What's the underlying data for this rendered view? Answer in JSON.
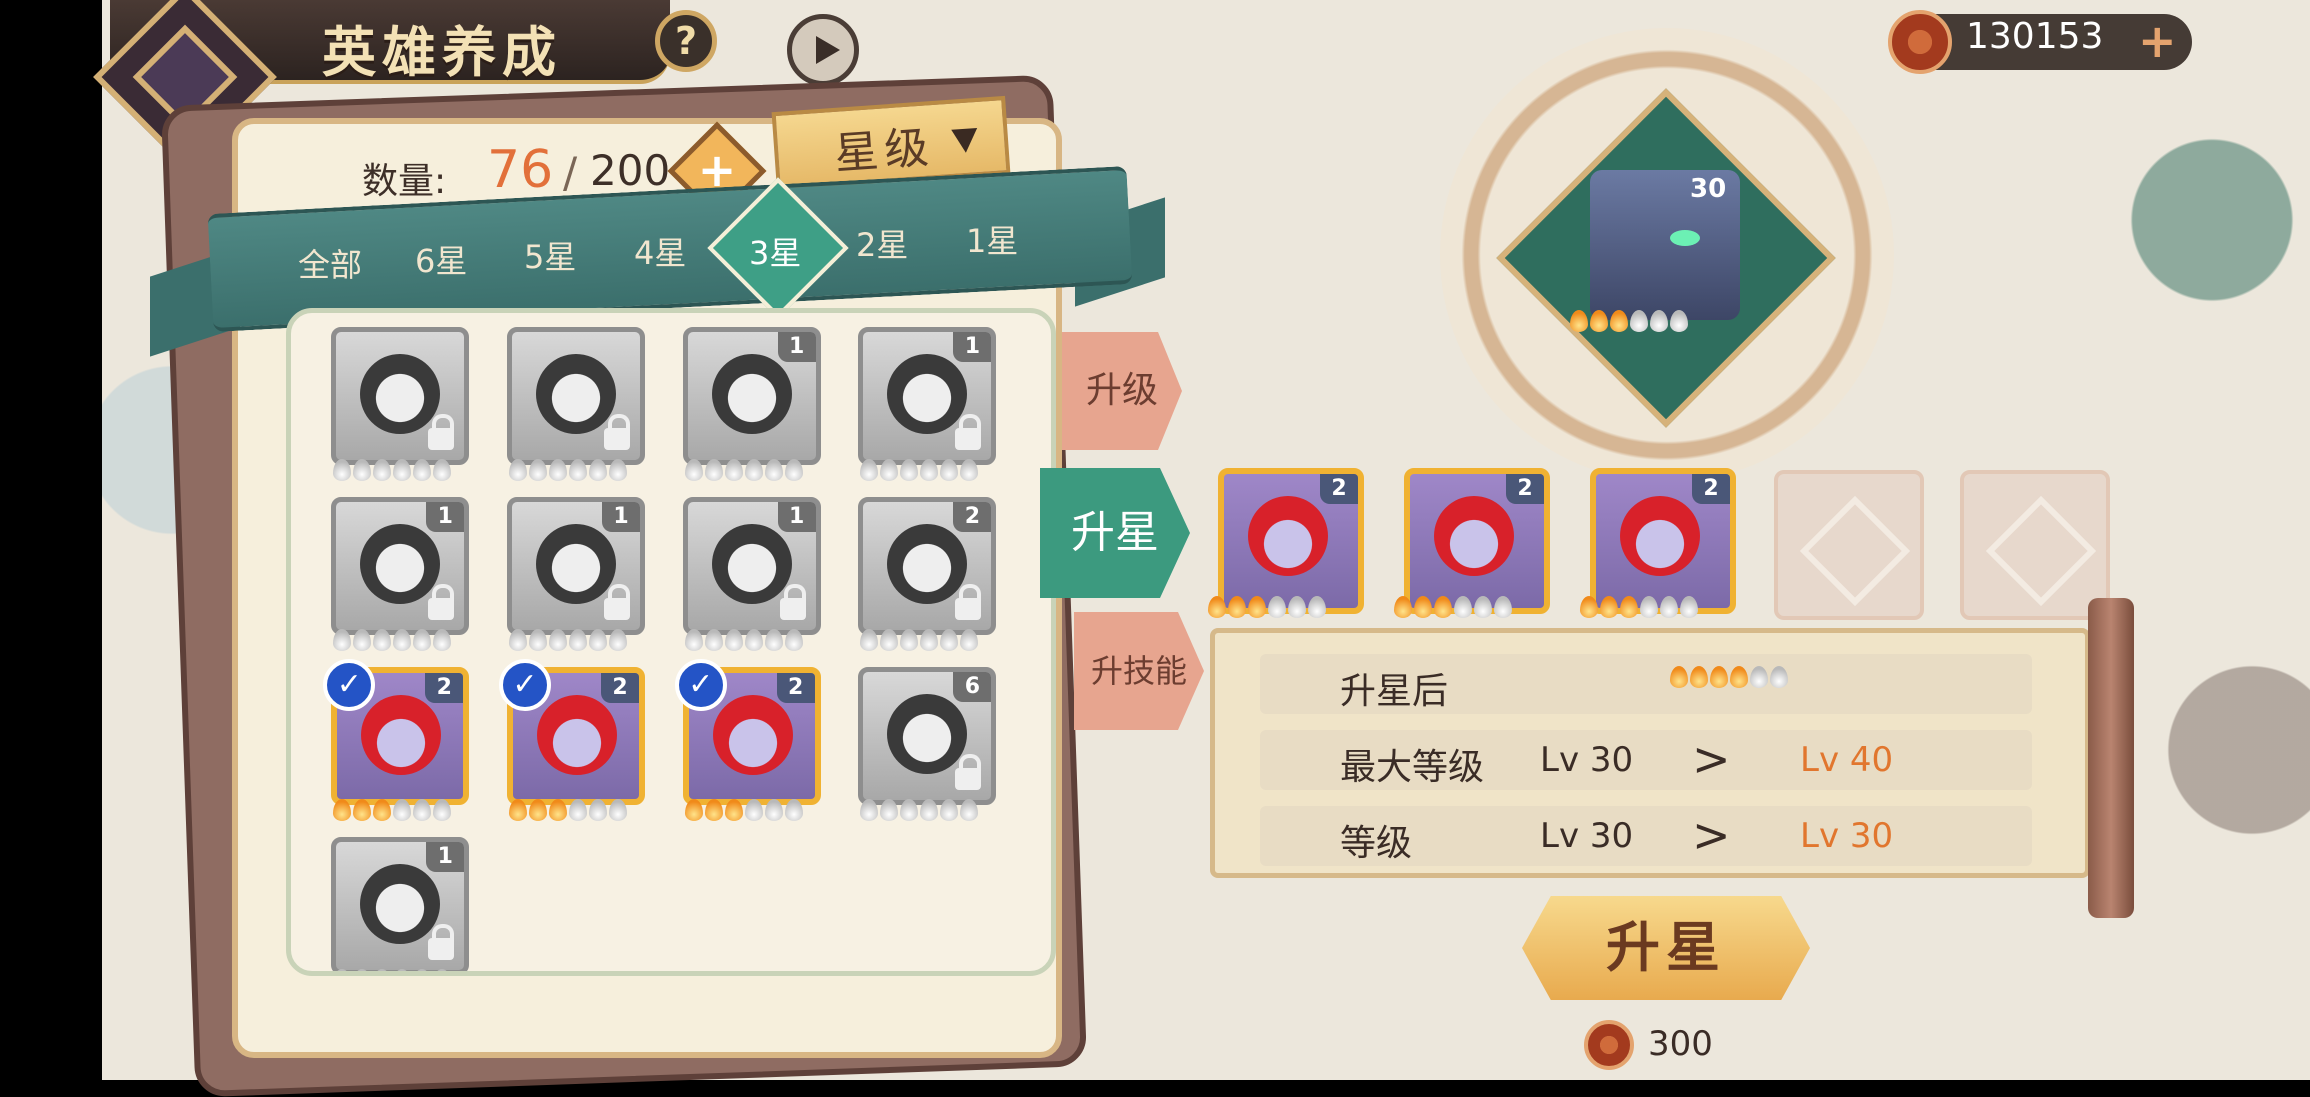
{
  "header": {
    "title": "英雄养成",
    "help": "?"
  },
  "currency": {
    "amount": "130153",
    "plus": "+"
  },
  "inventory": {
    "label": "数量:",
    "count": "76",
    "sep": "/",
    "max": "200",
    "plus": "+"
  },
  "sort": {
    "label": "星级"
  },
  "filter_tabs": [
    "全部",
    "6星",
    "5星",
    "4星",
    "3星",
    "2星",
    "1星"
  ],
  "active_tab": "3星",
  "heroes": [
    {
      "level": "",
      "stars_on": 0,
      "locked": true,
      "red": false,
      "selected": false
    },
    {
      "level": "",
      "stars_on": 0,
      "locked": true,
      "red": false,
      "selected": false
    },
    {
      "level": "1",
      "stars_on": 0,
      "locked": false,
      "red": false,
      "selected": false
    },
    {
      "level": "1",
      "stars_on": 0,
      "locked": true,
      "red": false,
      "selected": false
    },
    {
      "level": "1",
      "stars_on": 0,
      "locked": true,
      "red": false,
      "selected": false
    },
    {
      "level": "1",
      "stars_on": 0,
      "locked": true,
      "red": false,
      "selected": false
    },
    {
      "level": "1",
      "stars_on": 0,
      "locked": true,
      "red": false,
      "selected": false
    },
    {
      "level": "2",
      "stars_on": 0,
      "locked": true,
      "red": false,
      "selected": false
    },
    {
      "level": "2",
      "stars_on": 3,
      "locked": false,
      "red": true,
      "selected": true
    },
    {
      "level": "2",
      "stars_on": 3,
      "locked": false,
      "red": true,
      "selected": true
    },
    {
      "level": "2",
      "stars_on": 3,
      "locked": false,
      "red": true,
      "selected": true
    },
    {
      "level": "6",
      "stars_on": 0,
      "locked": true,
      "red": false,
      "selected": false
    },
    {
      "level": "1",
      "stars_on": 0,
      "locked": true,
      "red": false,
      "selected": false
    }
  ],
  "side_tabs": {
    "upgrade": "升级",
    "star_up": "升星",
    "skill": "升技能"
  },
  "target_hero": {
    "level": "30",
    "stars_on": 3,
    "stars_total": 6
  },
  "materials": [
    {
      "level": "2",
      "stars_on": 3
    },
    {
      "level": "2",
      "stars_on": 3
    },
    {
      "level": "2",
      "stars_on": 3
    }
  ],
  "info": {
    "after_label": "升星后",
    "after_stars_on": 4,
    "after_stars_total": 6,
    "rows": [
      {
        "label": "最大等级",
        "from": "Lv 30",
        "gt": ">",
        "to": "Lv 40"
      },
      {
        "label": "等级",
        "from": "Lv 30",
        "gt": ">",
        "to": "Lv 30"
      }
    ]
  },
  "action": {
    "label": "升星",
    "cost": "300"
  },
  "colors": {
    "accent": "#3c9a7f",
    "gold": "#e8aa4e",
    "orange": "#e1762e"
  }
}
